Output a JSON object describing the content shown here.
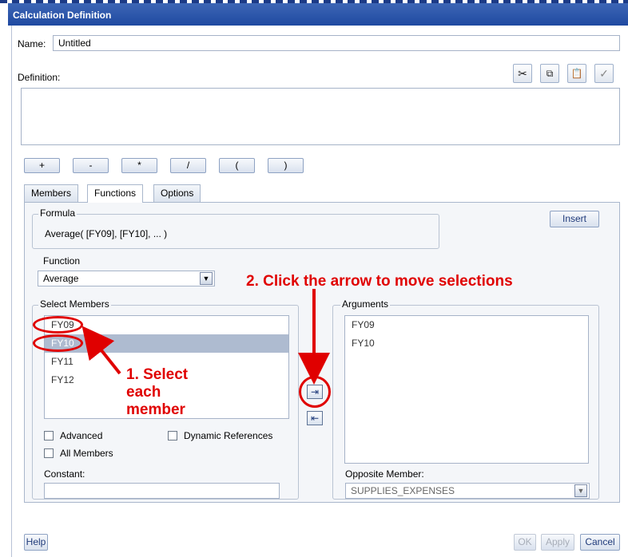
{
  "window": {
    "title": "Calculation Definition"
  },
  "name": {
    "label": "Name:",
    "value": "Untitled"
  },
  "definition": {
    "label": "Definition:",
    "value": ""
  },
  "toolbar": {
    "cut_icon": "scissors-icon",
    "copy_icon": "copy-icon",
    "paste_icon": "paste-icon",
    "validate_icon": "checkmark-icon"
  },
  "operators": [
    "+",
    "-",
    "*",
    "/",
    "(",
    ")"
  ],
  "tabs": [
    {
      "label": "Members"
    },
    {
      "label": "Functions",
      "active": true
    },
    {
      "label": "Options"
    }
  ],
  "formula": {
    "legend": "Formula",
    "text": "Average( [FY09], [FY10], ... )",
    "insert_label": "Insert"
  },
  "function": {
    "label": "Function",
    "selected": "Average"
  },
  "select_members": {
    "legend": "Select Members",
    "items": [
      {
        "label": "FY09",
        "selected": false
      },
      {
        "label": "FY10",
        "selected": true
      },
      {
        "label": "FY11",
        "selected": false
      },
      {
        "label": "FY12",
        "selected": false
      }
    ],
    "advanced_label": "Advanced",
    "dynamic_refs_label": "Dynamic References",
    "all_members_label": "All Members",
    "constant_label": "Constant:",
    "constant_value": ""
  },
  "arguments": {
    "legend": "Arguments",
    "items": [
      "FY09",
      "FY10"
    ],
    "opposite_label": "Opposite Member:",
    "opposite_value": "SUPPLIES_EXPENSES"
  },
  "annotations": {
    "step1_line1": "1. Select",
    "step1_line2": "each",
    "step1_line3": "member",
    "step2": "2. Click the arrow to move selections"
  },
  "footer": {
    "help": "Help",
    "ok": "OK",
    "apply": "Apply",
    "cancel": "Cancel"
  },
  "colors": {
    "annotation_red": "#e00000",
    "title_blue": "#2a54a8",
    "selected_row": "#aebbd0"
  }
}
